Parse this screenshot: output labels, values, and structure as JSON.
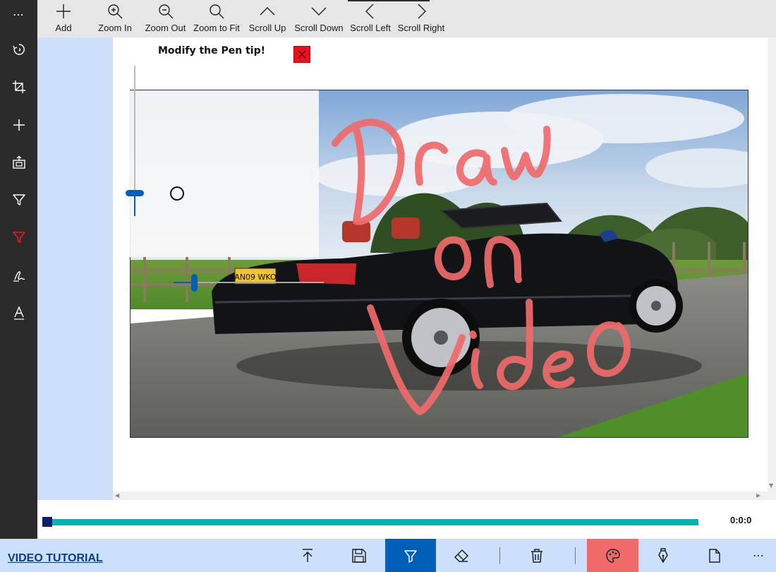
{
  "toolbar": {
    "add_label": "Add",
    "zoom_in_label": "Zoom In",
    "zoom_out_label": "Zoom Out",
    "zoom_to_fit_label": "Zoom to Fit",
    "scroll_up_label": "Scroll Up",
    "scroll_down_label": "Scroll Down",
    "scroll_left_label": "Scroll Left",
    "scroll_right_label": "Scroll Right"
  },
  "sidebar": {
    "more_label": "⋯",
    "items": [
      {
        "icon": "rotate-icon"
      },
      {
        "icon": "crop-icon"
      },
      {
        "icon": "add-icon"
      },
      {
        "icon": "export-icon"
      },
      {
        "icon": "filter-icon"
      },
      {
        "icon": "filter-active-icon",
        "color": "#e02020"
      },
      {
        "icon": "signature-icon"
      },
      {
        "icon": "text-icon"
      }
    ]
  },
  "pen_popup": {
    "title": "Modify the Pen tip!",
    "size_level": 0.14,
    "opacity_level": 0.14
  },
  "video": {
    "plate_text": "AN09 WKO"
  },
  "timeline": {
    "time": "0:0:0",
    "progress": 0
  },
  "bottom_bar": {
    "tutorial_label": "VIDEO TUTORIAL",
    "more_label": "⋯",
    "active_color": "#005fb8",
    "palette_color": "#f06a6a"
  },
  "colors": {
    "accent": "#005fb8",
    "timeline": "#00b4b4",
    "ink": "#f06a6a",
    "sidebar": "#2b2b2b",
    "canvas_margin": "#cce0fb"
  }
}
